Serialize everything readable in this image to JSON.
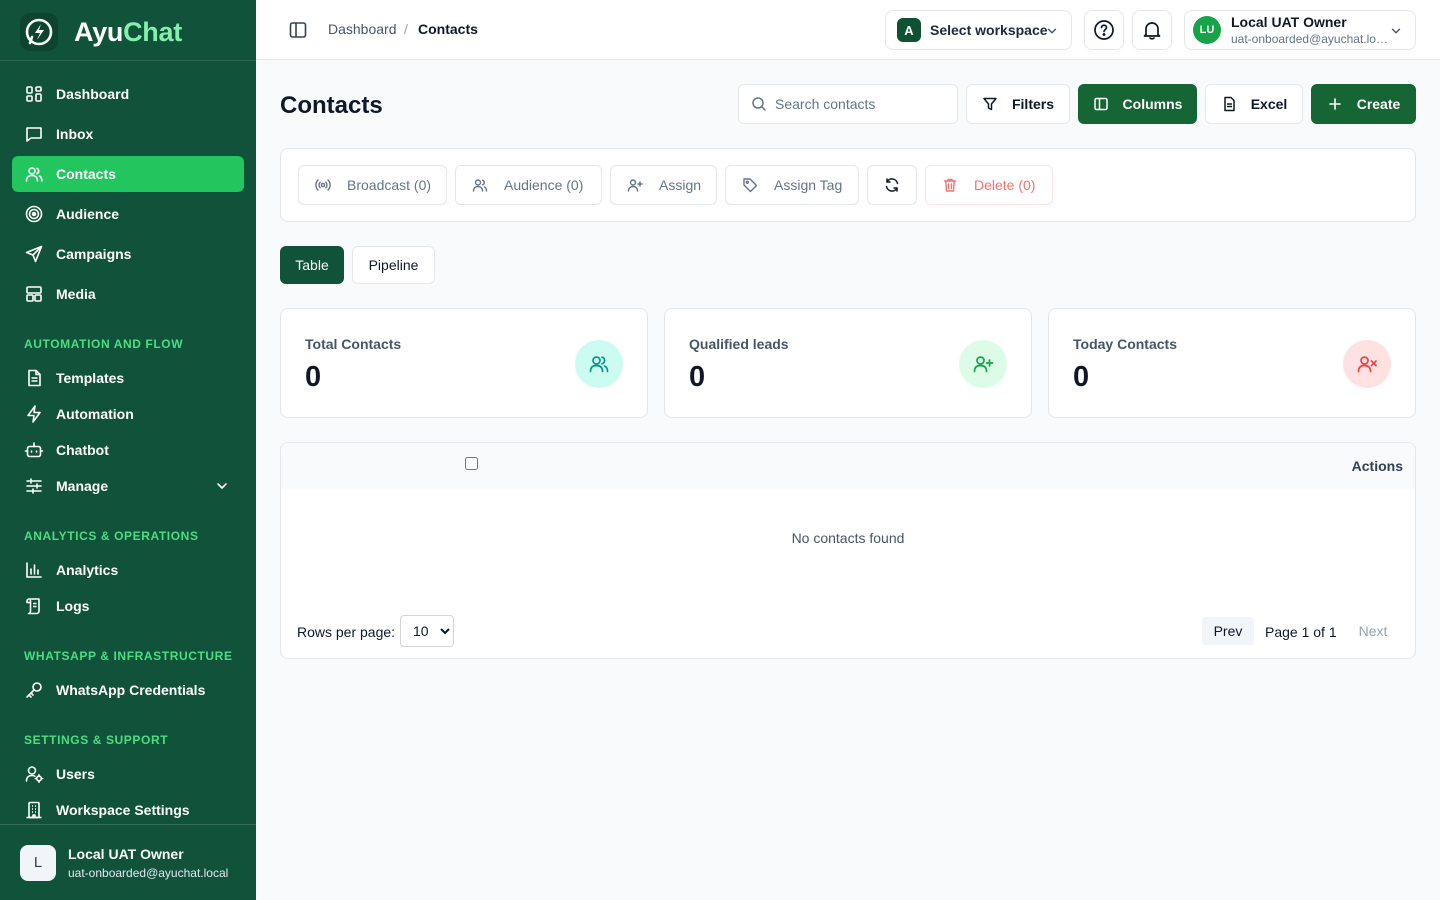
{
  "brand": {
    "name_part1": "Ayu",
    "name_part2": "Chat",
    "logo_icon": "bolt-chat-icon"
  },
  "sidebar": {
    "main_items": [
      {
        "label": "Dashboard",
        "icon": "grid-icon"
      },
      {
        "label": "Inbox",
        "icon": "message-icon"
      },
      {
        "label": "Contacts",
        "icon": "users-icon",
        "active": true
      },
      {
        "label": "Audience",
        "icon": "target-icon"
      },
      {
        "label": "Campaigns",
        "icon": "send-icon"
      },
      {
        "label": "Media",
        "icon": "layout-icon"
      }
    ],
    "sections": [
      {
        "title": "AUTOMATION AND FLOW",
        "items": [
          {
            "label": "Templates",
            "icon": "file-text-icon"
          },
          {
            "label": "Automation",
            "icon": "zap-icon"
          },
          {
            "label": "Chatbot",
            "icon": "bot-icon"
          },
          {
            "label": "Manage",
            "icon": "sliders-icon",
            "expandable": true
          }
        ]
      },
      {
        "title": "ANALYTICS & OPERATIONS",
        "items": [
          {
            "label": "Analytics",
            "icon": "bar-chart-icon"
          },
          {
            "label": "Logs",
            "icon": "scroll-icon"
          }
        ]
      },
      {
        "title": "WHATSAPP & INFRASTRUCTURE",
        "items": [
          {
            "label": "WhatsApp Credentials",
            "icon": "key-icon"
          }
        ]
      },
      {
        "title": "SETTINGS & SUPPORT",
        "items": [
          {
            "label": "Users",
            "icon": "user-cog-icon"
          },
          {
            "label": "Workspace Settings",
            "icon": "building-icon"
          }
        ]
      }
    ],
    "user": {
      "initial": "L",
      "name": "Local UAT Owner",
      "email": "uat-onboarded@ayuchat.local"
    }
  },
  "topbar": {
    "breadcrumb": [
      "Dashboard",
      "Contacts"
    ],
    "breadcrumb_sep": "/",
    "workspace": {
      "badge": "A",
      "label": "Select workspace"
    },
    "user": {
      "initials": "LU",
      "name": "Local UAT Owner",
      "email": "uat-onboarded@ayuchat.local"
    }
  },
  "page": {
    "title": "Contacts",
    "search_placeholder": "Search contacts",
    "actions": {
      "filters": "Filters",
      "columns": "Columns",
      "excel": "Excel",
      "create": "Create"
    },
    "toolbar": {
      "broadcast": "Broadcast (0)",
      "audience": "Audience (0)",
      "assign": "Assign",
      "assign_tag": "Assign Tag",
      "delete": "Delete (0)"
    },
    "views": {
      "table": "Table",
      "pipeline": "Pipeline"
    },
    "stats": [
      {
        "label": "Total Contacts",
        "value": "0",
        "icon": "users-icon",
        "bg": "#ccfbf1",
        "fg": "#0d9488"
      },
      {
        "label": "Qualified leads",
        "value": "0",
        "icon": "user-plus-icon",
        "bg": "#dcfce7",
        "fg": "#16a34a"
      },
      {
        "label": "Today Contacts",
        "value": "0",
        "icon": "user-x-icon",
        "bg": "#fee2e2",
        "fg": "#ef4444"
      }
    ],
    "table": {
      "actions_header": "Actions",
      "empty_message": "No contacts found",
      "rows_per_page_label": "Rows per page:",
      "rows_per_page_value": "10",
      "rows_per_page_options": [
        "10"
      ],
      "prev": "Prev",
      "page_info": "Page 1 of 1",
      "next": "Next"
    }
  },
  "colors": {
    "sidebar_bg": "#10523a",
    "accent": "#22c55e",
    "primary_button": "#166534",
    "section_title": "#4ade80"
  }
}
